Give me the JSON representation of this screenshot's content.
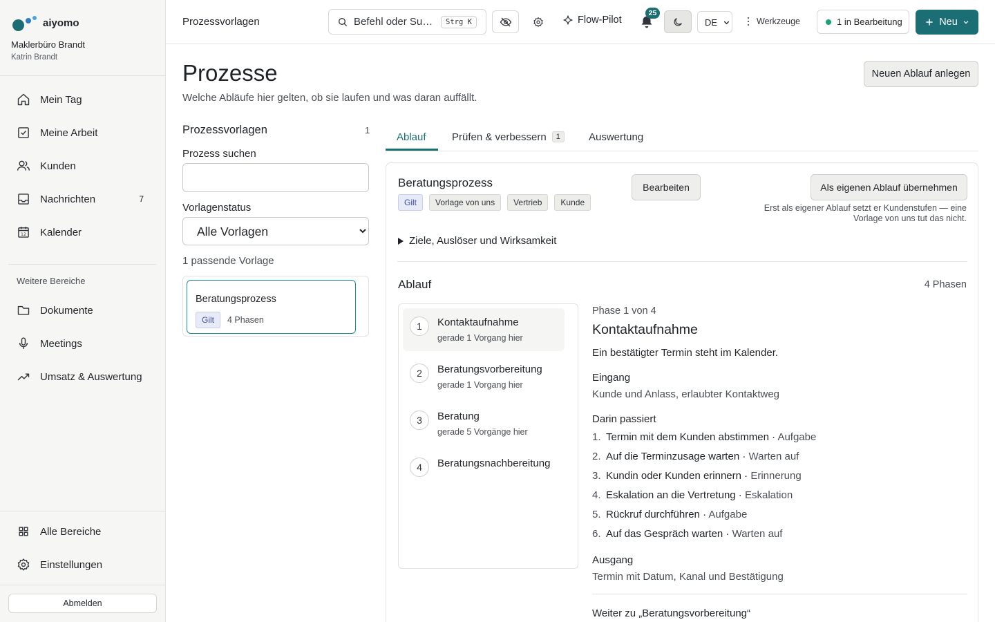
{
  "brand": {
    "name": "aiyomo",
    "org": "Maklerbüro Brandt",
    "user": "Katrin Brandt"
  },
  "sidebar": {
    "main_items": [
      {
        "label": "Mein Tag",
        "icon": "home-icon"
      },
      {
        "label": "Meine Arbeit",
        "icon": "checkbox-icon"
      },
      {
        "label": "Kunden",
        "icon": "users-icon"
      },
      {
        "label": "Nachrichten",
        "icon": "inbox-icon",
        "badge": "7"
      },
      {
        "label": "Kalender",
        "icon": "calendar-icon",
        "icon_text": "12"
      }
    ],
    "section_label": "Weitere Bereiche",
    "more_items": [
      {
        "label": "Dokumente",
        "icon": "folder-icon"
      },
      {
        "label": "Meetings",
        "icon": "microphone-icon"
      },
      {
        "label": "Umsatz & Auswertung",
        "icon": "trend-icon"
      }
    ],
    "bottom_items": [
      {
        "label": "Alle Bereiche",
        "icon": "grid-icon"
      },
      {
        "label": "Einstellungen",
        "icon": "gear-icon"
      }
    ],
    "logout_label": "Abmelden"
  },
  "topbar": {
    "breadcrumb": "Prozessvorlagen",
    "search_text": "Befehl oder Suche",
    "search_shortcut": "Strg K",
    "flow_pilot": "Flow-Pilot",
    "notifications_count": "25",
    "language": "DE",
    "tools_label": "Werkzeuge",
    "status_label": "1 in Bearbeitung",
    "new_label": "Neu",
    "accent": "#1b6e74"
  },
  "page": {
    "title": "Prozesse",
    "subtitle": "Welche Abläufe hier gelten, ob sie laufen und was daran auffällt.",
    "new_flow_button": "Neuen Ablauf anlegen"
  },
  "templates": {
    "heading": "Prozessvorlagen",
    "count": "1",
    "search_label": "Prozess suchen",
    "search_value": "",
    "status_label": "Vorlagenstatus",
    "status_selected": "Alle Vorlagen",
    "match_count": "1 passende Vorlage",
    "items": [
      {
        "name": "Beratungsprozess",
        "tag": "Gilt",
        "phases": "4 Phasen"
      }
    ]
  },
  "tabs": [
    {
      "label": "Ablauf",
      "active": true
    },
    {
      "label": "Prüfen & verbessern",
      "count": "1"
    },
    {
      "label": "Auswertung"
    }
  ],
  "process": {
    "title": "Beratungsprozess",
    "tags": [
      "Gilt",
      "Vorlage von uns",
      "Vertrieb",
      "Kunde"
    ],
    "edit_button": "Bearbeiten",
    "adopt_button": "Als eigenen Ablauf übernehmen",
    "adopt_note": "Erst als eigener Ablauf setzt er Kundenstufen — eine Vorlage von uns tut das nicht.",
    "details_summary": "Ziele, Auslöser und Wirksamkeit",
    "flow_heading": "Ablauf",
    "phase_count": "4 Phasen",
    "phases": [
      {
        "num": "1",
        "name": "Kontaktaufnahme",
        "sub": "gerade 1 Vorgang hier"
      },
      {
        "num": "2",
        "name": "Beratungsvorbereitung",
        "sub": "gerade 1 Vorgang hier"
      },
      {
        "num": "3",
        "name": "Beratung",
        "sub": "gerade 5 Vorgänge hier"
      },
      {
        "num": "4",
        "name": "Beratungsnachbereitung",
        "sub": ""
      }
    ]
  },
  "phase_detail": {
    "kicker": "Phase 1 von 4",
    "title": "Kontaktaufnahme",
    "description": "Ein bestätigter Termin steht im Kalender.",
    "input_label": "Eingang",
    "input_value": "Kunde und Anlass, erlaubter Kontaktweg",
    "steps_label": "Darin passiert",
    "steps": [
      {
        "num": "1.",
        "name": "Termin mit dem Kunden abstimmen",
        "type": "Aufgabe"
      },
      {
        "num": "2.",
        "name": "Auf die Terminzusage warten",
        "type": "Warten auf"
      },
      {
        "num": "3.",
        "name": "Kundin oder Kunden erinnern",
        "type": "Erinnerung"
      },
      {
        "num": "4.",
        "name": "Eskalation an die Vertretung",
        "type": "Eskalation"
      },
      {
        "num": "5.",
        "name": "Rückruf durchführen",
        "type": "Aufgabe"
      },
      {
        "num": "6.",
        "name": "Auf das Gespräch warten",
        "type": "Warten auf"
      }
    ],
    "output_label": "Ausgang",
    "output_value": "Termin mit Datum, Kanal und Bestätigung",
    "next_link": "Weiter zu „Beratungsvorbereitung“"
  }
}
